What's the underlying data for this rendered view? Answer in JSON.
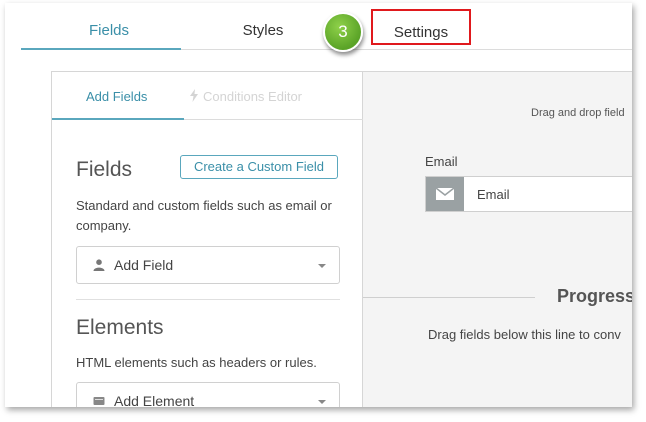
{
  "top_tabs": {
    "fields": "Fields",
    "styles": "Styles",
    "settings": "Settings"
  },
  "step_badge": "3",
  "left_panel": {
    "subtabs": {
      "add_fields": "Add Fields",
      "conditions_editor": "Conditions Editor"
    },
    "fields_section": {
      "title": "Fields",
      "create_button": "Create a Custom Field",
      "description": "Standard and custom fields such as email or company.",
      "dropdown_label": "Add Field"
    },
    "elements_section": {
      "title": "Elements",
      "description": "HTML elements such as headers or rules.",
      "dropdown_label": "Add Element"
    }
  },
  "canvas": {
    "drag_hint": "Drag and drop field",
    "email_label": "Email",
    "email_placeholder": "Email",
    "progress_title": "Progress",
    "progress_hint": "Drag fields below this line to conv"
  },
  "colors": {
    "accent": "#3a8fa8",
    "highlight_border": "#e0191d",
    "badge_green": "#6cb52f",
    "canvas_bg": "#f4f4f4"
  },
  "icons": {
    "conditions_editor": "lightning-icon",
    "add_field": "person-icon",
    "add_element": "card-icon",
    "email": "envelope-icon"
  }
}
